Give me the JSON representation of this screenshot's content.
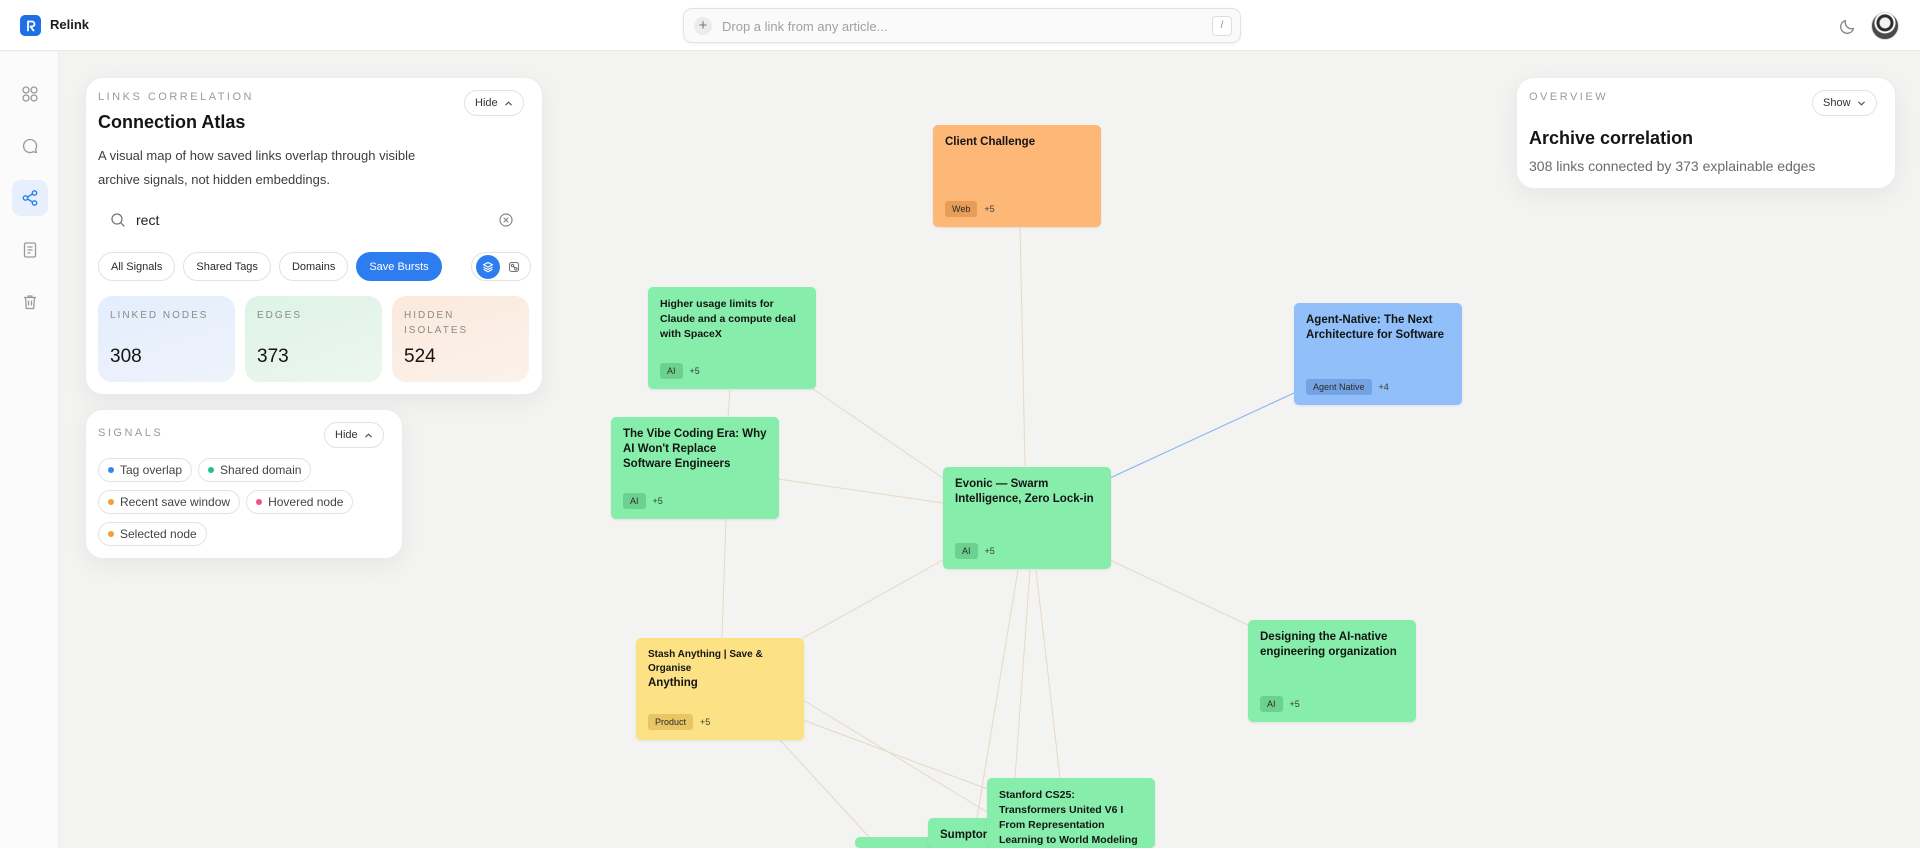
{
  "app": {
    "name": "Relink"
  },
  "link_bar": {
    "placeholder": "Drop a link from any article...",
    "shortcut": "/"
  },
  "rail": {
    "icons": [
      "grid-icon",
      "chat-icon",
      "share-graph-icon",
      "notebook-icon",
      "trash-icon"
    ],
    "active": "share-graph-icon"
  },
  "atlas_panel": {
    "kicker": "LINKS CORRELATION",
    "title": "Connection Atlas",
    "toggle_label": "Hide",
    "description": "A visual map of how saved links overlap through visible archive signals, not hidden embeddings.",
    "search_value": "rect",
    "filters": [
      {
        "label": "All Signals",
        "active": false
      },
      {
        "label": "Shared Tags",
        "active": false
      },
      {
        "label": "Domains",
        "active": false
      },
      {
        "label": "Save Bursts",
        "active": true
      }
    ],
    "view_modes": [
      "layers-icon",
      "clusters-icon"
    ],
    "stats": [
      {
        "label": "LINKED NODES",
        "value": "308"
      },
      {
        "label": "EDGES",
        "value": "373"
      },
      {
        "label": "HIDDEN ISOLATES",
        "value": "524"
      }
    ]
  },
  "signals_panel": {
    "kicker": "SIGNALS",
    "toggle_label": "Hide",
    "items": [
      {
        "label": "Tag overlap",
        "color": "#3b82f6"
      },
      {
        "label": "Shared domain",
        "color": "#22c08a"
      },
      {
        "label": "Recent save window",
        "color": "#f0a030"
      },
      {
        "label": "Hovered node",
        "color": "#f0508a"
      },
      {
        "label": "Selected node",
        "color": "#f0a030"
      }
    ]
  },
  "overview_panel": {
    "kicker": "OVERVIEW",
    "toggle_label": "Show",
    "title": "Archive correlation",
    "subtitle": "308 links connected by 373 explainable edges"
  },
  "nodes": [
    {
      "title": "Client Challenge",
      "tag": "Web",
      "more": "+5",
      "color": "orange"
    },
    {
      "title": "Higher usage limits for Claude and a compute deal with SpaceX",
      "tag": "AI",
      "more": "+5",
      "color": "green"
    },
    {
      "title": "Agent-Native: The Next Architecture for Software",
      "tag": "Agent Native",
      "more": "+4",
      "color": "blue"
    },
    {
      "title": "The Vibe Coding Era: Why AI Won't Replace Software Engineers",
      "tag": "AI",
      "more": "+5",
      "color": "green"
    },
    {
      "title": "Evonic — Swarm Intelligence, Zero Lock-in",
      "tag": "AI",
      "more": "+5",
      "color": "green"
    },
    {
      "title": "Designing the AI-native engineering organization",
      "tag": "AI",
      "more": "+5",
      "color": "green"
    },
    {
      "title_small": "Stash Anything | Save & Organise",
      "title": "Anything",
      "tag": "Product",
      "more": "+5",
      "color": "yellow"
    },
    {
      "title": "Stanford CS25: Transformers United V6 I From Representation Learning to World Modeling",
      "tag": "",
      "more": "",
      "color": "green"
    },
    {
      "title": "Sumpton",
      "tag": "",
      "more": "",
      "color": "green"
    }
  ],
  "colors": {
    "accent": "#2e7df0",
    "node_green": "#86eeaa",
    "node_orange": "#fdb877",
    "node_blue": "#90bff9",
    "node_yellow": "#fde285"
  }
}
